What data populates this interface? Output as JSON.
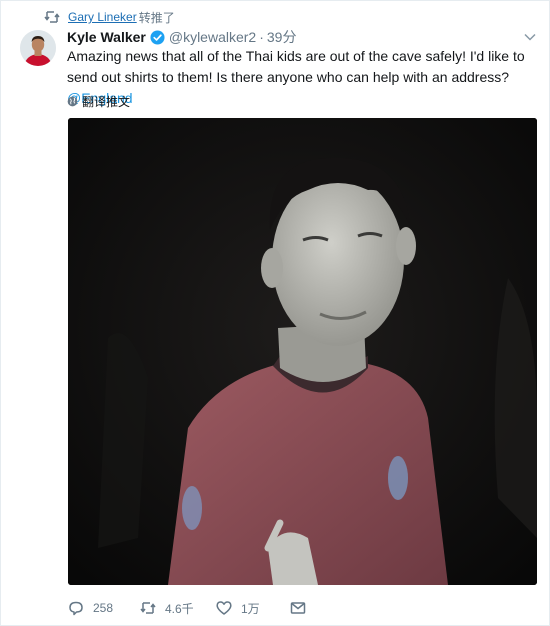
{
  "retweet": {
    "retweeter_name": "Gary Lineker",
    "suffix": "转推了"
  },
  "tweet": {
    "author_name": "Kyle Walker",
    "handle": "@kylewalker2",
    "separator": "·",
    "time": "39分",
    "text_before_mention": "Amazing news that all of the Thai kids are out of the cave safely! I'd like to send out shirts to them! Is there anyone who can help with an address? ",
    "mention": "@England",
    "translate_label": "翻译推文"
  },
  "actions": {
    "replies": "258",
    "retweets": "4.6千",
    "likes": "1万"
  },
  "colors": {
    "link_blue": "#1b95e0",
    "muted_gray": "#657786",
    "text_dark": "#14171a",
    "verified_blue": "#1da1f2"
  },
  "icons": {
    "retweet_label_icon": "retweet-icon",
    "verified": "verified-badge-icon",
    "caret": "chevron-down-icon",
    "translate": "globe-icon",
    "reply": "reply-icon",
    "retweet": "retweet-icon",
    "like": "heart-icon",
    "dm": "envelope-icon"
  }
}
